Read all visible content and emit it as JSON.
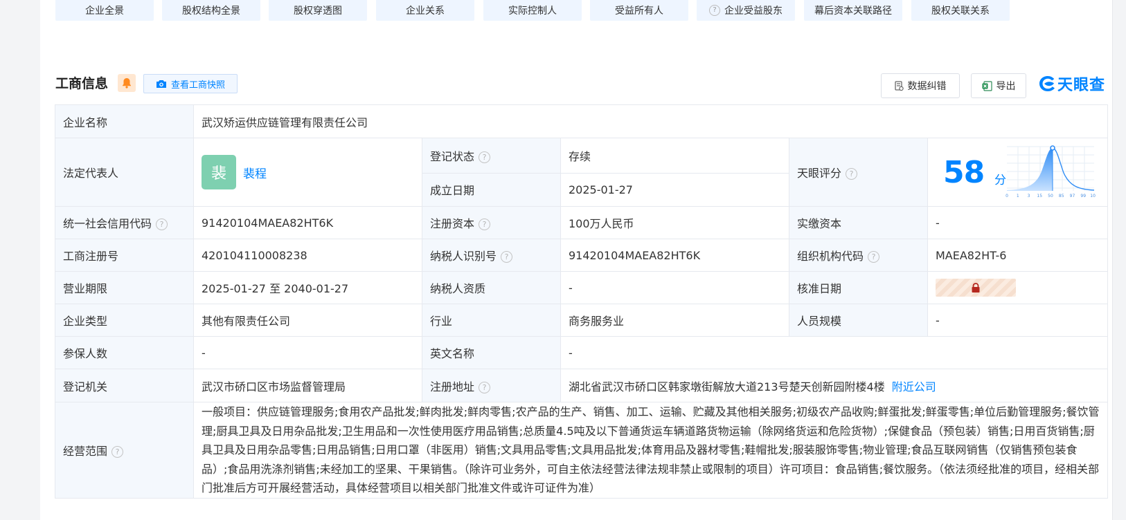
{
  "tabs": [
    {
      "label": "企业全景",
      "help": false
    },
    {
      "label": "股权结构全景",
      "help": false
    },
    {
      "label": "股权穿透图",
      "help": false
    },
    {
      "label": "企业关系",
      "help": false
    },
    {
      "label": "实际控制人",
      "help": false
    },
    {
      "label": "受益所有人",
      "help": false
    },
    {
      "label": "企业受益股东",
      "help": true
    },
    {
      "label": "幕后资本关联路径",
      "help": false
    },
    {
      "label": "股权关联关系",
      "help": false
    }
  ],
  "section": {
    "title": "工商信息",
    "snapshot_label": "查看工商快照",
    "correct_label": "数据纠错",
    "export_label": "导出",
    "logo_text": "天眼查"
  },
  "info": {
    "company_name_label": "企业名称",
    "company_name": "武汉矫运供应链管理有限责任公司",
    "legal_rep_label": "法定代表人",
    "legal_rep_avatar": "裴",
    "legal_rep": "裴程",
    "reg_status_label": "登记状态",
    "reg_status": "存续",
    "found_date_label": "成立日期",
    "found_date": "2025-01-27",
    "score_label": "天眼评分",
    "score": "58",
    "score_unit": "分",
    "score_ticks": [
      "0",
      "1",
      "3",
      "15",
      "50",
      "85",
      "97",
      "99",
      "100"
    ],
    "credit_code_label": "统一社会信用代码",
    "credit_code": "91420104MAEA82HT6K",
    "reg_capital_label": "注册资本",
    "reg_capital": "100万人民币",
    "paid_capital_label": "实缴资本",
    "paid_capital": "-",
    "biz_reg_no_label": "工商注册号",
    "biz_reg_no": "420104110008238",
    "taxpayer_id_label": "纳税人识别号",
    "taxpayer_id": "91420104MAEA82HT6K",
    "org_code_label": "组织机构代码",
    "org_code": "MAEA82HT-6",
    "term_label": "营业期限",
    "term": "2025-01-27 至 2040-01-27",
    "taxpayer_qual_label": "纳税人资质",
    "taxpayer_qual": "-",
    "approve_date_label": "核准日期",
    "company_type_label": "企业类型",
    "company_type": "其他有限责任公司",
    "industry_label": "行业",
    "industry": "商务服务业",
    "staff_size_label": "人员规模",
    "staff_size": "-",
    "insured_label": "参保人数",
    "insured": "-",
    "english_name_label": "英文名称",
    "english_name": "-",
    "authority_label": "登记机关",
    "authority": "武汉市硚口区市场监督管理局",
    "address_label": "注册地址",
    "address": "湖北省武汉市硚口区韩家墩街解放大道213号楚天创新园附楼4楼",
    "nearby_label": "附近公司",
    "scope_label": "经营范围",
    "scope": "一般项目：供应链管理服务;食用农产品批发;鲜肉批发;鲜肉零售;农产品的生产、销售、加工、运输、贮藏及其他相关服务;初级农产品收购;鲜蛋批发;鲜蛋零售;单位后勤管理服务;餐饮管理;厨具卫具及日用杂品批发;卫生用品和一次性使用医疗用品销售;总质量4.5吨及以下普通货运车辆道路货物运输（除网络货运和危险货物）;保健食品（预包装）销售;日用百货销售;厨具卫具及日用杂品零售;日用品销售;日用口罩（非医用）销售;文具用品零售;文具用品批发;体育用品及器材零售;鞋帽批发;服装服饰零售;物业管理;食品互联网销售（仅销售预包装食品）;食品用洗涤剂销售;未经加工的坚果、干果销售。（除许可业务外，可自主依法经营法律法规非禁止或限制的项目）许可项目：食品销售;餐饮服务。（依法须经批准的项目，经相关部门批准后方可开展经营活动，具体经营项目以相关部门批准文件或许可证件为准）"
  },
  "colors": {
    "accent": "#0084ff",
    "status_green": "#009944",
    "label_bg": "#f4f8fd",
    "avatar_bg": "#7ed0b0"
  },
  "icons": [
    "question-icon",
    "bell-icon",
    "camera-icon",
    "feedback-icon",
    "excel-icon",
    "lock-icon",
    "tianyancha-logo-icon"
  ]
}
